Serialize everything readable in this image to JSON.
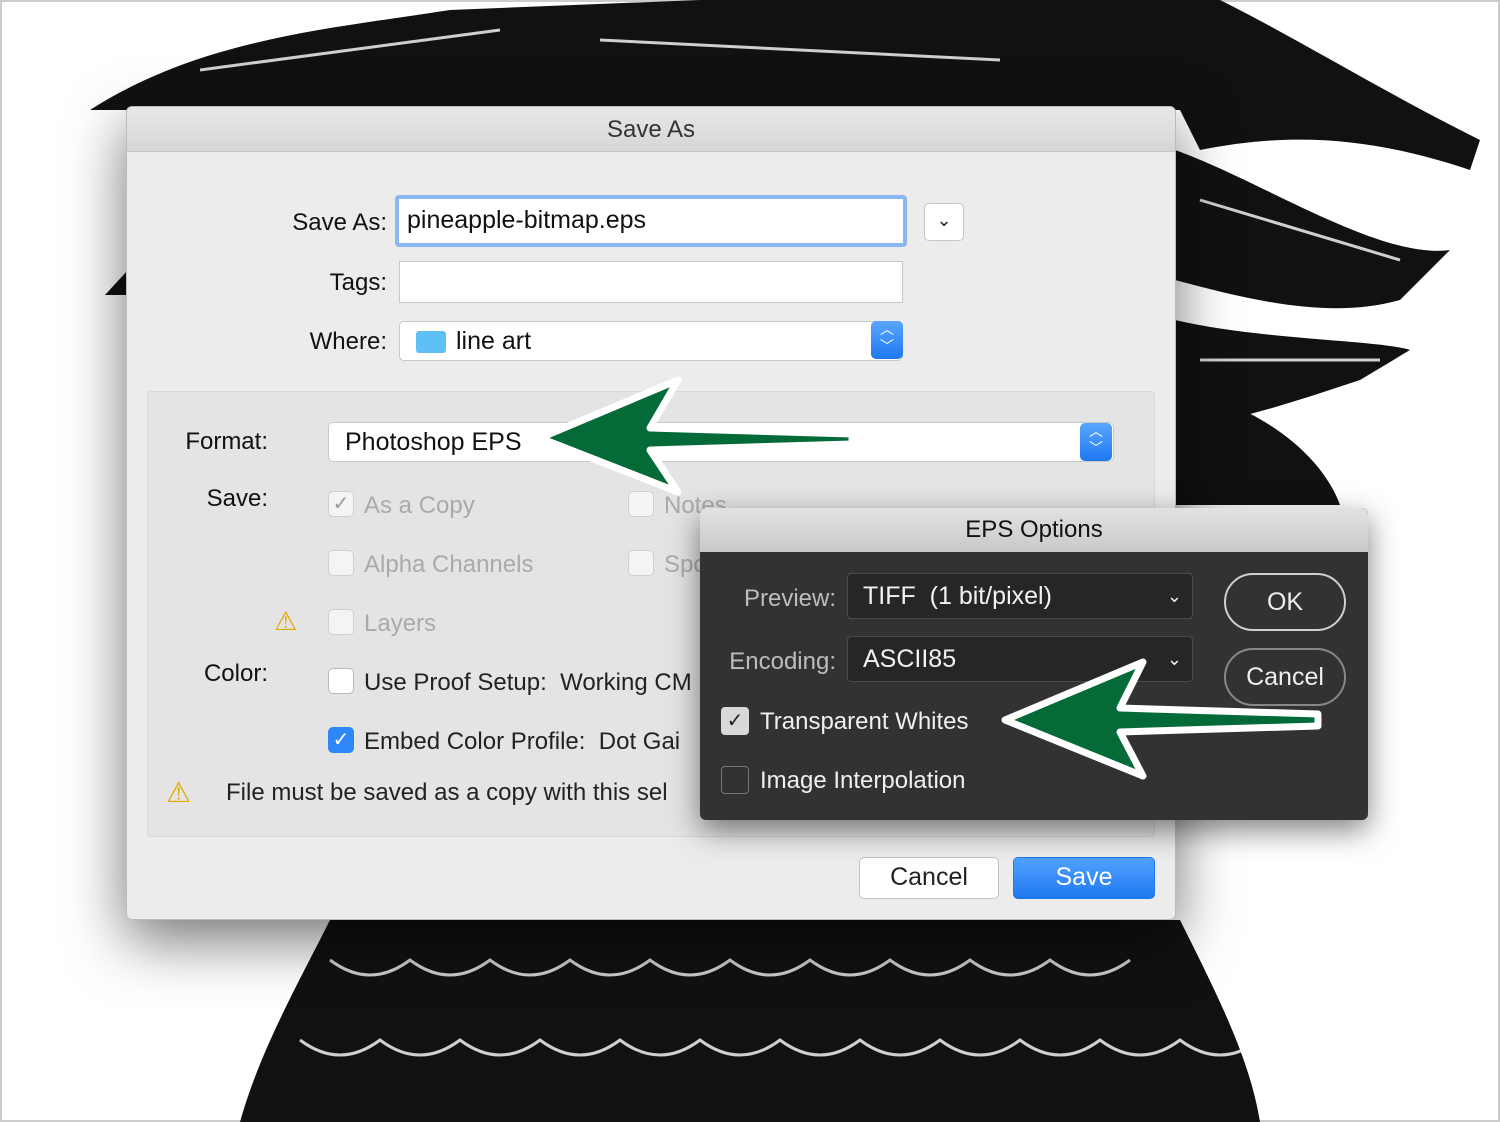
{
  "save_dialog": {
    "title": "Save As",
    "save_as_label": "Save As:",
    "filename": "pineapple-bitmap.eps",
    "tags_label": "Tags:",
    "tags_value": "",
    "where_label": "Where:",
    "where_value": "line art",
    "format_label": "Format:",
    "format_value": "Photoshop EPS",
    "save_label": "Save:",
    "options": [
      {
        "label": "As a Copy",
        "checked": true,
        "enabled": false
      },
      {
        "label": "Notes",
        "checked": false,
        "enabled": false
      },
      {
        "label": "Alpha Channels",
        "checked": false,
        "enabled": false
      },
      {
        "label": "Spo",
        "checked": false,
        "enabled": false
      },
      {
        "label": "Layers",
        "checked": false,
        "enabled": false
      }
    ],
    "color_label": "Color:",
    "use_proof": {
      "label": "Use Proof Setup:  Working CM",
      "checked": false
    },
    "embed_profile": {
      "label": "Embed Color Profile:  Dot Gai",
      "checked": true
    },
    "warning": "File must be saved as a copy with this sel",
    "cancel": "Cancel",
    "save": "Save"
  },
  "eps_options": {
    "title": "EPS Options",
    "preview_label": "Preview:",
    "preview_value": "TIFF  (1 bit/pixel)",
    "encoding_label": "Encoding:",
    "encoding_value": "ASCII85",
    "transparent_whites": {
      "label": "Transparent Whites",
      "checked": true
    },
    "image_interpolation": {
      "label": "Image Interpolation",
      "checked": false
    },
    "ok": "OK",
    "cancel": "Cancel"
  },
  "colors": {
    "accent": "#1f78f0",
    "arrow": "#046a38",
    "warning": "#f5c400"
  }
}
